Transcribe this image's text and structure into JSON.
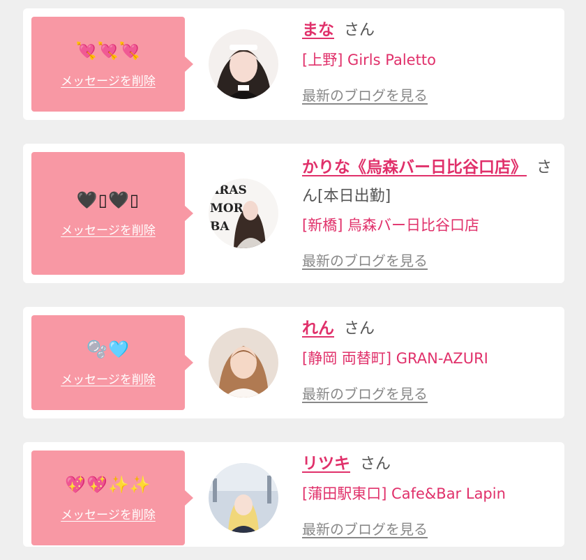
{
  "delete_label": "メッセージを削除",
  "blog_label": "最新のブログを見る",
  "san_label": "さん",
  "colors": {
    "background": "#efefef",
    "card": "#ffffff",
    "bubble": "#f898a4",
    "accent": "#e0306a",
    "muted": "#888888"
  },
  "cards": [
    {
      "emoji": "💘💘💘",
      "emoji_icon": "heart-with-arrow-icons",
      "name": "まな",
      "name_suffix": "",
      "shop": "[上野] Girls Paletto"
    },
    {
      "emoji": "🖤▯🖤▯",
      "emoji_icon": "black-heart-icons",
      "name": "かりな《烏森バー日比谷口店》",
      "name_suffix": "[本日出勤]",
      "shop": "[新橋] 烏森バー日比谷口店"
    },
    {
      "emoji": "🫧🩵",
      "emoji_icon": "bubbles-light-blue-heart-icons",
      "name": "れん",
      "name_suffix": "",
      "shop": "[静岡 両替町] GRAN-AZURI"
    },
    {
      "emoji": "💖💖✨✨",
      "emoji_icon": "sparkling-heart-sparkles-icons",
      "name": "リツキ",
      "name_suffix": "",
      "shop": "[蒲田駅東口] Cafe&Bar Lapin"
    }
  ]
}
